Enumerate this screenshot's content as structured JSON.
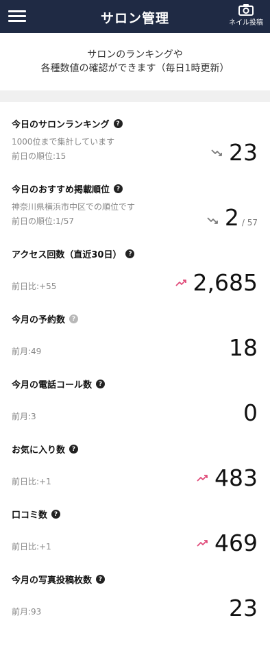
{
  "header": {
    "title": "サロン管理",
    "post_label": "ネイル投稿",
    "menu_icon": "hamburger-menu-icon",
    "camera_icon": "camera-icon"
  },
  "intro": "サロンのランキングや\n各種数値の確認ができます（毎日1時更新）",
  "colors": {
    "header_bg": "#1f2a44",
    "trend_up": "#e04c7a",
    "trend_down": "#7a7a7a"
  },
  "metrics": [
    {
      "title": "今日のサロンランキング",
      "sub": "1000位まで集計しています",
      "prev": "前日の順位:15",
      "value": "23",
      "trend": "down",
      "help": "dark"
    },
    {
      "title": "今日のおすすめ掲載順位",
      "sub": "神奈川県横浜市中区での順位です",
      "prev": "前日の順位:1/57",
      "value": "2",
      "denom": "/ 57",
      "trend": "down",
      "help": "dark"
    },
    {
      "title": "アクセス回数（直近30日）",
      "prev": "前日比:+55",
      "value": "2,685",
      "trend": "up",
      "help": "dark"
    },
    {
      "title": "今月の予約数",
      "prev": "前月:49",
      "value": "18",
      "help": "grey"
    },
    {
      "title": "今月の電話コール数",
      "prev": "前月:3",
      "value": "0",
      "help": "dark"
    },
    {
      "title": "お気に入り数",
      "prev": "前日比:+1",
      "value": "483",
      "trend": "up",
      "help": "dark"
    },
    {
      "title": "口コミ数",
      "prev": "前日比:+1",
      "value": "469",
      "trend": "up",
      "help": "dark"
    },
    {
      "title": "今月の写真投稿枚数",
      "prev": "前月:93",
      "value": "23",
      "help": "dark"
    }
  ]
}
